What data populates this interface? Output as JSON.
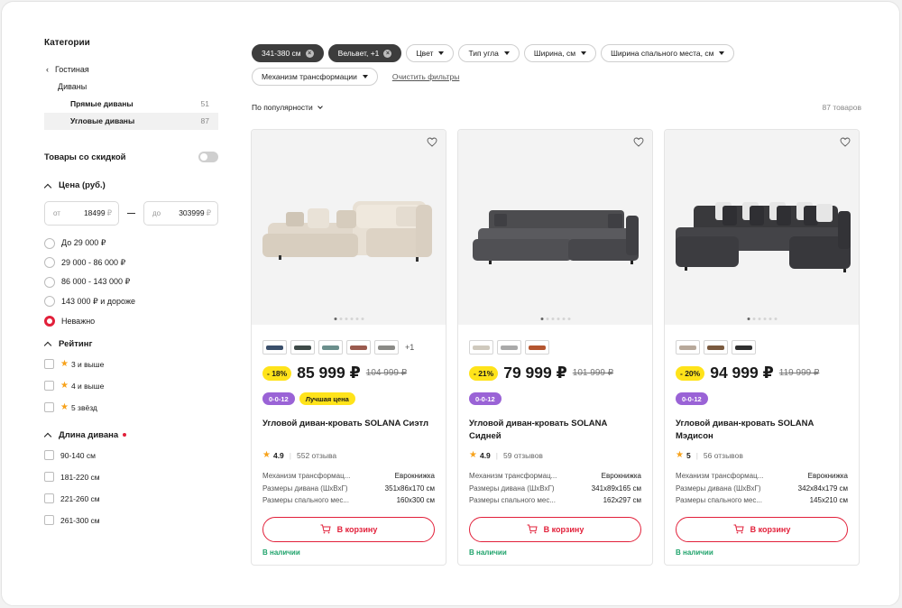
{
  "sidebar": {
    "title": "Категории",
    "back_label": "Гостиная",
    "sub_label": "Диваны",
    "items": [
      {
        "label": "Прямые диваны",
        "count": "51"
      },
      {
        "label": "Угловые диваны",
        "count": "87"
      }
    ],
    "discount_label": "Товары со скидкой",
    "price": {
      "title": "Цена (руб.)",
      "from_label": "от",
      "from_value": "18499",
      "to_label": "до",
      "to_value": "303999",
      "currency": "₽",
      "options": [
        "До 29 000 ₽",
        "29 000 - 86 000 ₽",
        "86 000 - 143 000 ₽",
        "143 000 ₽ и дороже",
        "Неважно"
      ],
      "selected_index": 4
    },
    "rating": {
      "title": "Рейтинг",
      "options": [
        "3 и выше",
        "4 и выше",
        "5 звёзд"
      ]
    },
    "length": {
      "title": "Длина дивана",
      "options": [
        "90-140 см",
        "181-220 см",
        "221-260 см",
        "261-300 см"
      ]
    }
  },
  "filters": {
    "chips": [
      "341-380 см",
      "Вельвет, +1",
      "Цвет",
      "Тип угла",
      "Ширина, см",
      "Ширина спального места, см",
      "Механизм трансформации"
    ],
    "clear_label": "Очистить фильтры"
  },
  "sort": {
    "label": "По популярности",
    "total": "87 товаров"
  },
  "products": [
    {
      "swatches": [
        "#3a4f6b",
        "#3e4a48",
        "#6b8f8c",
        "#9a5a4e",
        "#8a8a86"
      ],
      "more_swatches": "+1",
      "discount": "- 18%",
      "price": "85 999 ₽",
      "old_price": "104 999 ₽",
      "badges": [
        "0-0-12",
        "Лучшая цена"
      ],
      "title": "Угловой диван-кровать SOLANA Сиэтл",
      "rating": "4.9",
      "reviews": "552 отзыва",
      "specs": [
        {
          "k": "Механизм трансформац...",
          "v": "Еврокнижка"
        },
        {
          "k": "Размеры дивана (ШхВхГ)",
          "v": "351х86х170 см"
        },
        {
          "k": "Размеры спального мес...",
          "v": "160х300 см"
        }
      ],
      "cart_label": "В корзину",
      "stock": "В наличии"
    },
    {
      "swatches": [
        "#cfc9bd",
        "#a9a9a9",
        "#b4552f"
      ],
      "more_swatches": "",
      "discount": "- 21%",
      "price": "79 999 ₽",
      "old_price": "101 999 ₽",
      "badges": [
        "0-0-12"
      ],
      "title": "Угловой диван-кровать SOLANA Сидней",
      "rating": "4.9",
      "reviews": "59 отзывов",
      "specs": [
        {
          "k": "Механизм трансформац...",
          "v": "Еврокнижка"
        },
        {
          "k": "Размеры дивана (ШхВхГ)",
          "v": "341х89х165 см"
        },
        {
          "k": "Размеры спального мес...",
          "v": "162х297 см"
        }
      ],
      "cart_label": "В корзину",
      "stock": "В наличии"
    },
    {
      "swatches": [
        "#b7a89a",
        "#7a5a3f",
        "#2f2f2f"
      ],
      "more_swatches": "",
      "discount": "- 20%",
      "price": "94 999 ₽",
      "old_price": "119 999 ₽",
      "badges": [
        "0-0-12"
      ],
      "title": "Угловой диван-кровать SOLANA Мэдисон",
      "rating": "5",
      "reviews": "56 отзывов",
      "specs": [
        {
          "k": "Механизм трансформац...",
          "v": "Еврокнижка"
        },
        {
          "k": "Размеры дивана (ШхВхГ)",
          "v": "342х84х179 см"
        },
        {
          "k": "Размеры спального мес...",
          "v": "145х210 см"
        }
      ],
      "cart_label": "В корзину",
      "stock": "В наличии"
    }
  ]
}
